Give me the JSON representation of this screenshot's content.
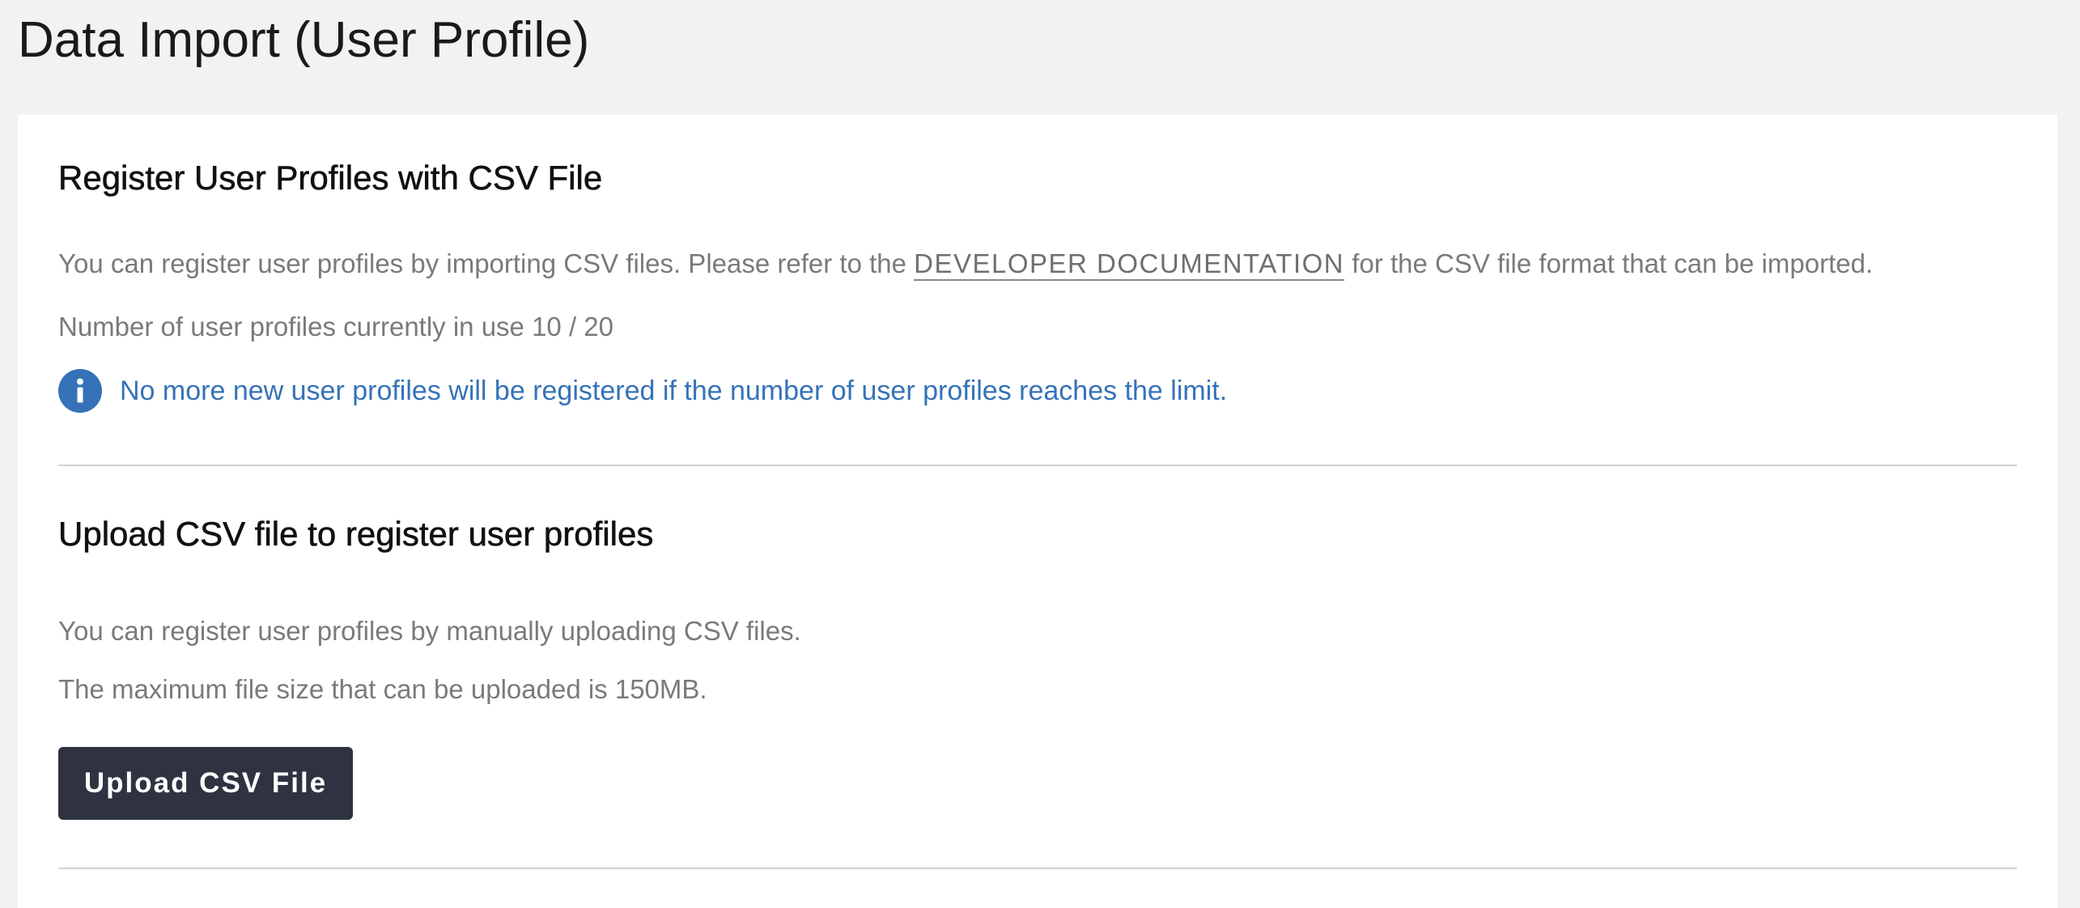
{
  "page": {
    "title": "Data Import (User Profile)"
  },
  "register_section": {
    "heading": "Register User Profiles with CSV File",
    "description_before_link": "You can register user profiles by importing CSV files. Please refer to the ",
    "doc_link_label": "DEVELOPER DOCUMENTATION",
    "description_after_link": " for the CSV file format that can be imported.",
    "usage_text": "Number of user profiles currently in use 10 / 20",
    "usage_current": 10,
    "usage_limit": 20,
    "info_icon": "info-icon",
    "info_message": "No more new user profiles will be registered if the number of user profiles reaches the limit."
  },
  "upload_section": {
    "heading": "Upload CSV file to register user profiles",
    "description": "You can register user profiles by manually uploading CSV files.",
    "max_size_text": "The maximum file size that can be uploaded is 150MB.",
    "upload_button_label": "Upload CSV File"
  },
  "colors": {
    "page_background": "#f2f2f2",
    "card_background": "#ffffff",
    "info_blue": "#3572b8",
    "button_dark": "#2f3341",
    "muted_text": "#7a7a7a"
  }
}
